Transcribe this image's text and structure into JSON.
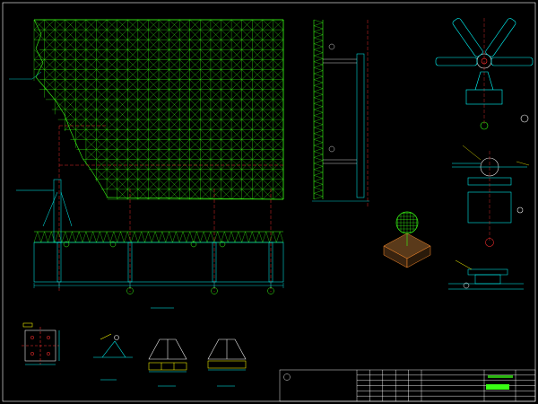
{
  "colors": {
    "background": "#000000",
    "frame": "#ffffff",
    "truss": "#39ff14",
    "member": "#00ffff",
    "axis": "#ff3030",
    "leader": "#ffff00",
    "label": "#ffffff"
  },
  "column_grid": {
    "ticks": [
      "",
      "",
      "",
      "",
      ""
    ],
    "axis_labels": [
      "",
      "",
      "",
      ""
    ]
  },
  "dimensions": {
    "plate1": "",
    "plate2": "",
    "rib1": "",
    "rib2": ""
  },
  "title_block": {
    "company": "",
    "row_texts": [
      "",
      "",
      "",
      ""
    ]
  }
}
